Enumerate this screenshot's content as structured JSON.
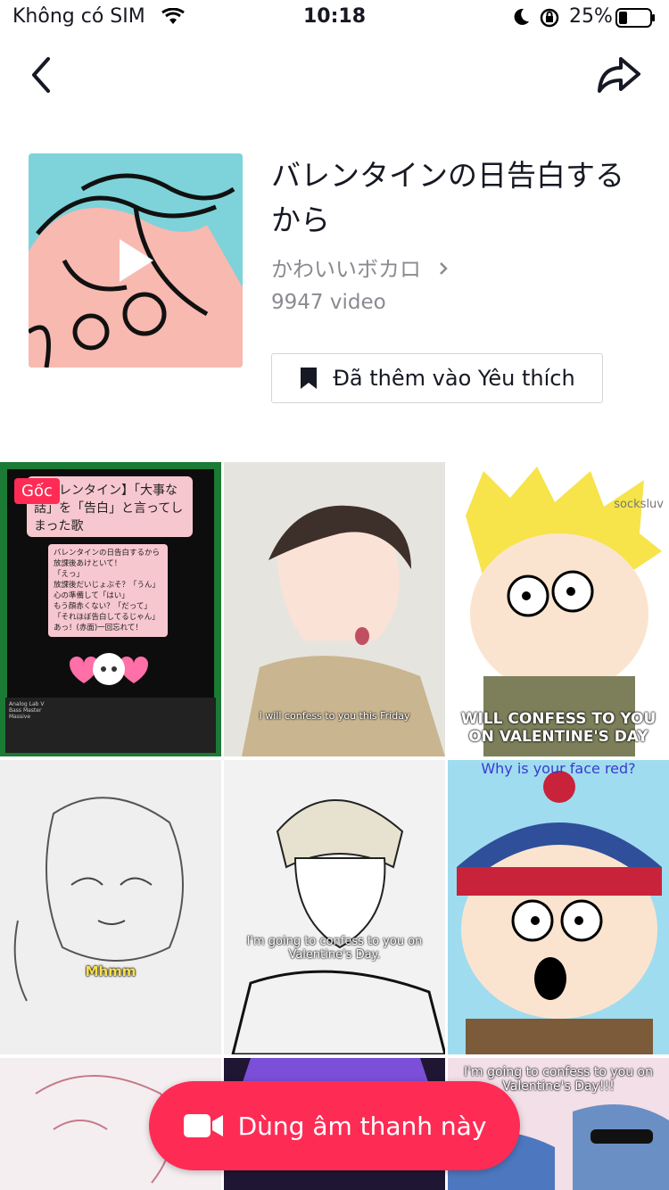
{
  "status": {
    "carrier": "Không có SIM",
    "time": "10:18",
    "battery": "25%"
  },
  "sound": {
    "title": "バレンタインの日告白するから",
    "artist": "かわいいボカロ",
    "video_count": "9947 video",
    "favorite_label": "Đã thêm vào Yêu thích"
  },
  "videos": [
    {
      "badge": "Gốc",
      "card_title": "【バレンタイン】「大事な話」を「告白」と言ってしまった歌",
      "lyrics": [
        "バレンタインの日告白するから",
        "放課後あけといて！",
        "「えっ」",
        "放課後だいじょぶそ？「うん」",
        "心の準備して「はい」",
        "もう顔赤くない？「だって」",
        "「それほぼ告白してるじゃん」",
        "あっ！(赤面)一回忘れて！"
      ],
      "tracks": [
        "Analog Lab V",
        "Bass Master",
        "Massive"
      ]
    },
    {
      "caption": "I will confess to you this Friday"
    },
    {
      "caption_top": "socksluv",
      "caption": "WILL CONFESS TO YOU ON VALENTINE'S DAY"
    },
    {
      "caption": "Mhmm"
    },
    {
      "caption": "I'm going to confess to you on Valentine's Day."
    },
    {
      "caption_top": "Why is your face red?"
    },
    {},
    {},
    {
      "caption": "I'm going to confess to you on Valentine's Day!!!"
    }
  ],
  "action": {
    "use_sound_label": "Dùng âm thanh này"
  },
  "colors": {
    "accent": "#fe2c55",
    "secondary_text": "#8a8b91"
  }
}
